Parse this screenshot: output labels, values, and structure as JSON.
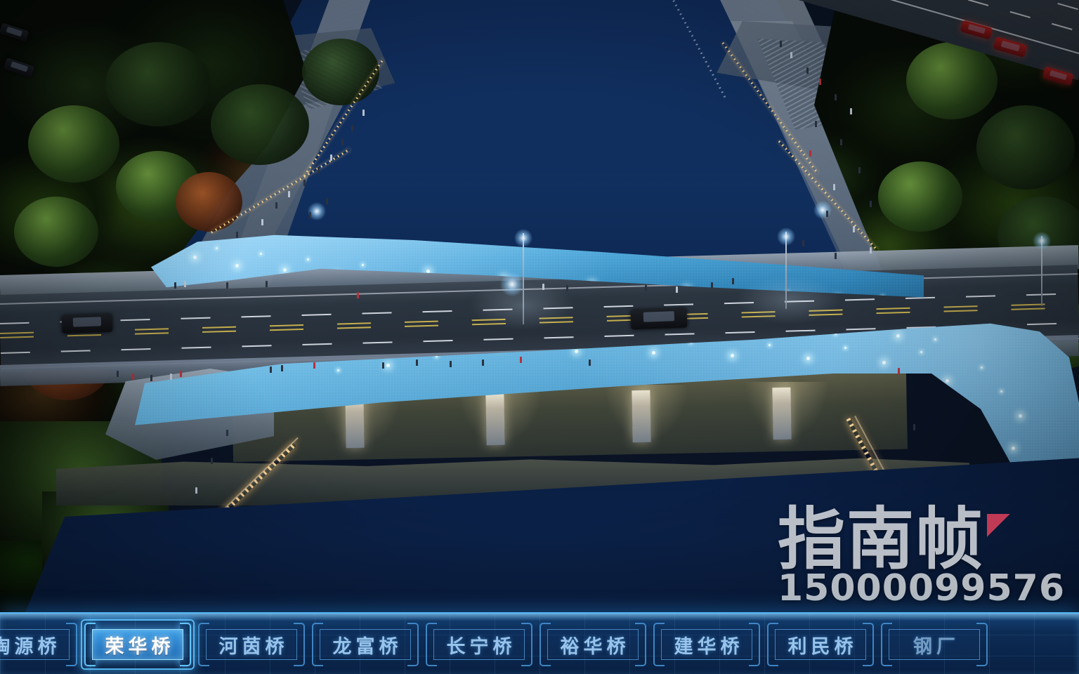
{
  "scene": {
    "kind": "night-aerial-architectural-rendering",
    "subject": "illuminated pedestrian bridge over urban river"
  },
  "watermark": {
    "brand": "指南帧",
    "phone": "15000099576",
    "accent_color": "#e8415c"
  },
  "navbar": {
    "accent_color": "#57b8f5",
    "active_fill": "#2f86ce",
    "active_index": 1,
    "items": [
      {
        "label": "陶源桥",
        "active": false,
        "partial": false
      },
      {
        "label": "荣华桥",
        "active": true,
        "partial": false
      },
      {
        "label": "河茵桥",
        "active": false,
        "partial": false
      },
      {
        "label": "龙富桥",
        "active": false,
        "partial": false
      },
      {
        "label": "长宁桥",
        "active": false,
        "partial": false
      },
      {
        "label": "裕华桥",
        "active": false,
        "partial": false
      },
      {
        "label": "建华桥",
        "active": false,
        "partial": false
      },
      {
        "label": "利民桥",
        "active": false,
        "partial": false
      },
      {
        "label": "钢厂",
        "active": false,
        "partial": true
      }
    ]
  }
}
